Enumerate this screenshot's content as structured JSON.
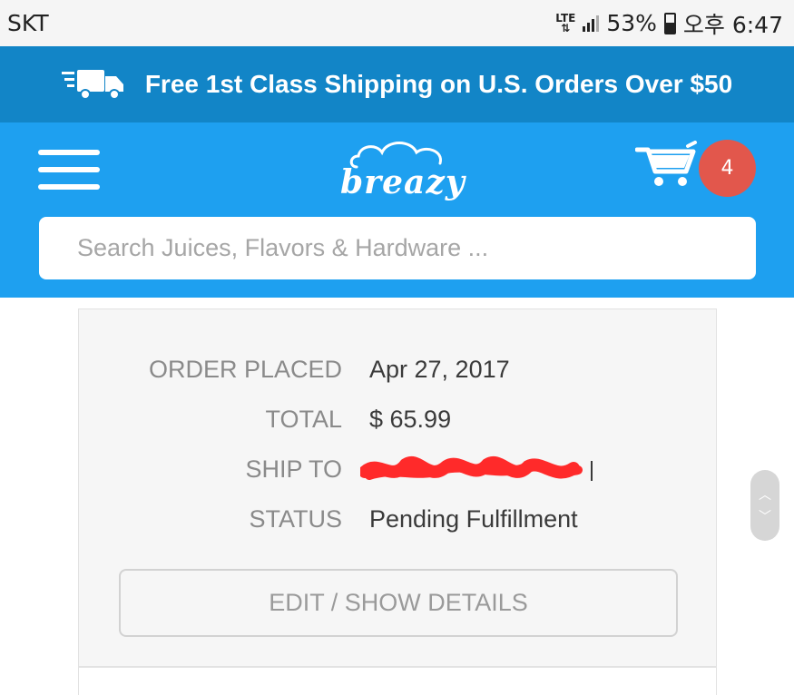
{
  "status_bar": {
    "carrier": "SKT",
    "network": "LTE",
    "battery": "53%",
    "time": "오후 6:47"
  },
  "promo": {
    "icon": "truck-icon",
    "text": "Free 1st Class Shipping on U.S. Orders Over $50"
  },
  "header": {
    "logo": "breazy",
    "cart_count": "4",
    "menu_icon": "hamburger-icon",
    "cart_icon": "cart-icon"
  },
  "search": {
    "placeholder": "Search Juices, Flavors & Hardware ...",
    "value": ""
  },
  "order": {
    "fields": [
      {
        "label": "ORDER PLACED",
        "value": "Apr 27, 2017"
      },
      {
        "label": "TOTAL",
        "value": "$ 65.99"
      },
      {
        "label": "SHIP TO",
        "value": ""
      },
      {
        "label": "STATUS",
        "value": "Pending Fulfillment"
      }
    ],
    "button_label": "EDIT / SHOW DETAILS"
  },
  "colors": {
    "promo_bg": "#1285c7",
    "header_bg": "#1ea0f0",
    "badge": "#e2574c",
    "redaction": "#ff2a2a"
  }
}
